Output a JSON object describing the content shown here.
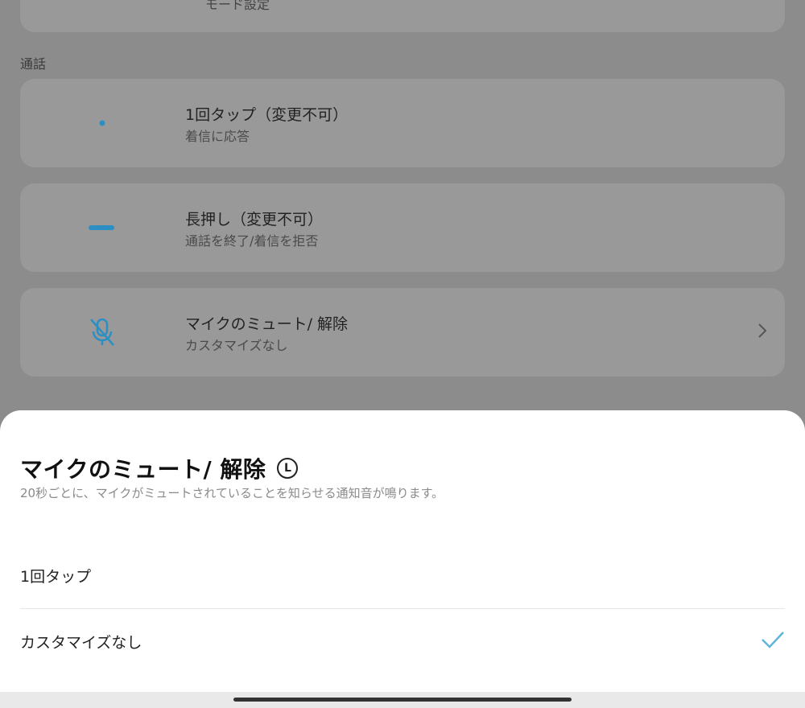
{
  "background": {
    "top_card_text": "モード設定",
    "section_label": "通話",
    "items": [
      {
        "title": "1回タップ（変更不可）",
        "subtitle": "着信に応答",
        "icon": "dot-icon"
      },
      {
        "title": "長押し（変更不可）",
        "subtitle": "通話を終了/着信を拒否",
        "icon": "dash-icon"
      },
      {
        "title": "マイクのミュート/ 解除",
        "subtitle": "カスタマイズなし",
        "icon": "mic-muted-icon"
      }
    ]
  },
  "sheet": {
    "title": "マイクのミュート/ 解除",
    "badge": "L",
    "description": "20秒ごとに、マイクがミュートされていることを知らせる通知音が鳴ります。",
    "options": [
      {
        "label": "1回タップ",
        "selected": false
      },
      {
        "label": "カスタマイズなし",
        "selected": true
      }
    ]
  },
  "colors": {
    "accent": "#2b8fc4",
    "check": "#5fb5d9"
  }
}
